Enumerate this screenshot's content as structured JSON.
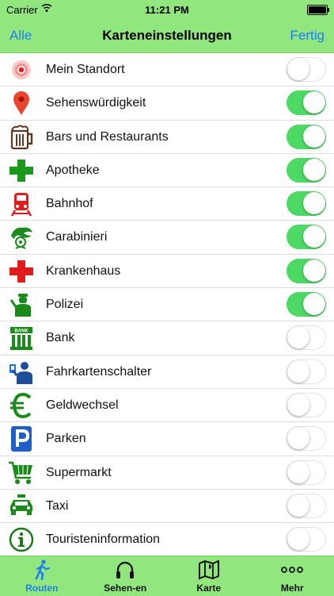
{
  "status_bar": {
    "carrier": "Carrier",
    "time": "11:21 PM"
  },
  "nav": {
    "left": "Alle",
    "title": "Karteneinstellungen",
    "right": "Fertig"
  },
  "rows": [
    {
      "label": "Mein Standort",
      "icon": "location-dot-icon",
      "on": false
    },
    {
      "label": "Sehenswürdigkeit",
      "icon": "map-pin-icon",
      "on": true
    },
    {
      "label": "Bars und Restaurants",
      "icon": "beer-mug-icon",
      "on": true
    },
    {
      "label": "Apotheke",
      "icon": "pharmacy-cross-icon",
      "on": true
    },
    {
      "label": "Bahnhof",
      "icon": "train-icon",
      "on": true
    },
    {
      "label": "Carabinieri",
      "icon": "carabinieri-icon",
      "on": true
    },
    {
      "label": "Krankenhaus",
      "icon": "hospital-cross-icon",
      "on": true
    },
    {
      "label": "Polizei",
      "icon": "police-icon",
      "on": true
    },
    {
      "label": "Bank",
      "icon": "bank-icon",
      "on": false
    },
    {
      "label": "Fahrkartenschalter",
      "icon": "ticket-office-icon",
      "on": false
    },
    {
      "label": "Geldwechsel",
      "icon": "euro-icon",
      "on": false
    },
    {
      "label": "Parken",
      "icon": "parking-icon",
      "on": false
    },
    {
      "label": "Supermarkt",
      "icon": "shopping-cart-icon",
      "on": false
    },
    {
      "label": "Taxi",
      "icon": "taxi-icon",
      "on": false
    },
    {
      "label": "Touristeninformation",
      "icon": "info-icon",
      "on": false
    }
  ],
  "tabs": [
    {
      "label": "Routen",
      "icon": "walking-person-icon",
      "active": true
    },
    {
      "label": "Sehen-en",
      "icon": "headphones-icon",
      "active": false
    },
    {
      "label": "Karte",
      "icon": "map-icon",
      "active": false
    },
    {
      "label": "Mehr",
      "icon": "more-dots-icon",
      "active": false
    }
  ],
  "colors": {
    "bar": "#91e67d",
    "accent": "#1e7ff5",
    "toggle_on": "#4cd964",
    "icon_green": "#1a8a1a",
    "icon_red": "#e21b1b",
    "icon_blue": "#1e6fd8"
  }
}
